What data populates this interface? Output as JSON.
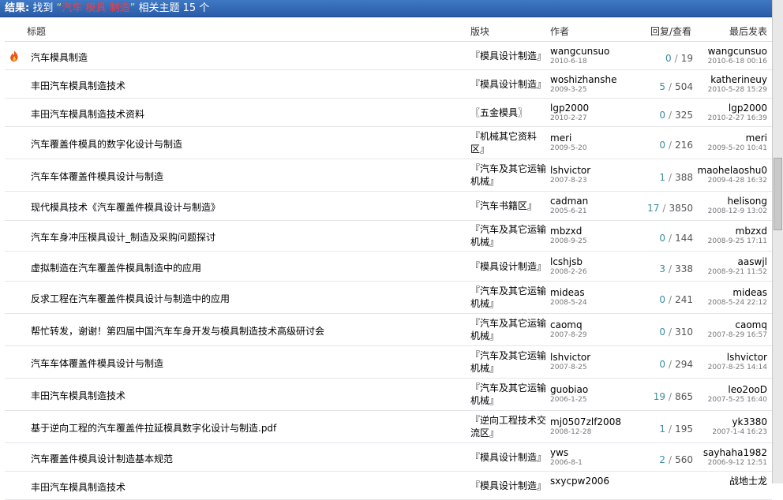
{
  "banner": {
    "label": "结果:",
    "found": "找到",
    "kw_open": "“",
    "k1": "汽车",
    "k2": "模具",
    "k3": "制造",
    "kw_close": "”",
    "suffix": "相关主题",
    "count": "15 个"
  },
  "columns": {
    "title": "标题",
    "forum": "版块",
    "author": "作者",
    "stat": "回复/查看",
    "last": "最后发表"
  },
  "rows": [
    {
      "title": "汽车模具制造",
      "forum": "『模具设计制造』",
      "author": "wangcunsuo",
      "adate": "2010-6-18",
      "replies": "0",
      "views": "19",
      "last": "wangcunsuo",
      "ldate": "2010-6-18 00:16",
      "hot": true,
      "h": 35
    },
    {
      "title": "丰田汽车模具制造技术",
      "forum": "『模具设计制造』",
      "author": "woshizhanshe",
      "adate": "2009-3-25",
      "replies": "5",
      "views": "504",
      "last": "katherineuy",
      "ldate": "2010-5-28 15:29",
      "hot": false,
      "h": 35
    },
    {
      "title": "丰田汽车模具制造技术资料",
      "forum": "〖五金模具〗",
      "author": "lgp2000",
      "adate": "2010-2-27",
      "replies": "0",
      "views": "325",
      "last": "lgp2000",
      "ldate": "2010-2-27 16:39",
      "hot": false,
      "h": 35
    },
    {
      "title": "汽车覆盖件模具的数字化设计与制造",
      "forum": "『机械其它资料区』",
      "author": "meri",
      "adate": "2009-5-20",
      "replies": "0",
      "views": "216",
      "last": "meri",
      "ldate": "2009-5-20 10:41",
      "hot": false,
      "h": 40
    },
    {
      "title": "汽车车体覆盖件模具设计与制造",
      "forum": "『汽车及其它运输机械』",
      "author": "lshvictor",
      "adate": "2007-8-23",
      "replies": "1",
      "views": "388",
      "last": "maohelaoshu0",
      "ldate": "2009-4-28 16:32",
      "hot": false,
      "h": 40
    },
    {
      "title": "现代模具技术《汽车覆盖件模具设计与制造》",
      "forum": "『汽车书籍区』",
      "author": "cadman",
      "adate": "2005-6-21",
      "replies": "17",
      "views": "3850",
      "last": "helisong",
      "ldate": "2008-12-9 13:02",
      "hot": false,
      "h": 36
    },
    {
      "title": "汽车车身冲压模具设计_制造及采购问题探讨",
      "forum": "『汽车及其它运输机械』",
      "author": "mbzxd",
      "adate": "2008-9-25",
      "replies": "0",
      "views": "144",
      "last": "mbzxd",
      "ldate": "2008-9-25 17:11",
      "hot": false,
      "h": 38
    },
    {
      "title": "虚拟制造在汽车覆盖件模具制造中的应用",
      "forum": "『模具设计制造』",
      "author": "lcshjsb",
      "adate": "2008-2-26",
      "replies": "3",
      "views": "338",
      "last": "aaswjl",
      "ldate": "2008-9-21 11:52",
      "hot": false,
      "h": 37
    },
    {
      "title": "反求工程在汽车覆盖件模具设计与制造中的应用",
      "forum": "『汽车及其它运输机械』",
      "author": "mideas",
      "adate": "2008-5-24",
      "replies": "0",
      "views": "241",
      "last": "mideas",
      "ldate": "2008-5-24 22:12",
      "hot": false,
      "h": 40
    },
    {
      "title": "帮忙转发，谢谢！第四届中国汽车车身开发与模具制造技术高级研讨会",
      "forum": "『汽车及其它运输机械』",
      "author": "caomq",
      "adate": "2007-8-29",
      "replies": "0",
      "views": "310",
      "last": "caomq",
      "ldate": "2007-8-29 16:57",
      "hot": false,
      "h": 40
    },
    {
      "title": "汽车车体覆盖件模具设计与制造",
      "forum": "『汽车及其它运输机械』",
      "author": "lshvictor",
      "adate": "2007-8-25",
      "replies": "0",
      "views": "294",
      "last": "lshvictor",
      "ldate": "2007-8-25 14:14",
      "hot": false,
      "h": 40
    },
    {
      "title": "丰田汽车模具制造技术",
      "forum": "『汽车及其它运输机械』",
      "author": "guobiao",
      "adate": "2006-1-25",
      "replies": "19",
      "views": "865",
      "last": "leo2ooD",
      "ldate": "2007-5-25 16:40",
      "hot": false,
      "h": 40
    },
    {
      "title": "基于逆向工程的汽车覆盖件拉延模具数字化设计与制造.pdf",
      "forum": "『逆向工程技术交流区』",
      "author": "mj0507zlf2008",
      "adate": "2008-12-28",
      "replies": "1",
      "views": "195",
      "last": "yk3380",
      "ldate": "2007-1-4 16:23",
      "hot": false,
      "h": 40
    },
    {
      "title": "汽车覆盖件模具设计制造基本规范",
      "forum": "『模具设计制造』",
      "author": "yws",
      "adate": "2006-8-1",
      "replies": "2",
      "views": "560",
      "last": "sayhaha1982",
      "ldate": "2006-9-12 12:51",
      "hot": false,
      "h": 35
    },
    {
      "title": "丰田汽车模具制造技术",
      "forum": "『模具设计制造』",
      "author": "sxycpw2006",
      "adate": "",
      "replies": "",
      "views": "",
      "last": "战地士龙",
      "ldate": "",
      "hot": false,
      "h": 35
    }
  ],
  "colors": {
    "banner": "#2a5ca8",
    "keyword": "#ff3a3a",
    "reply": "#3a8ea0"
  }
}
